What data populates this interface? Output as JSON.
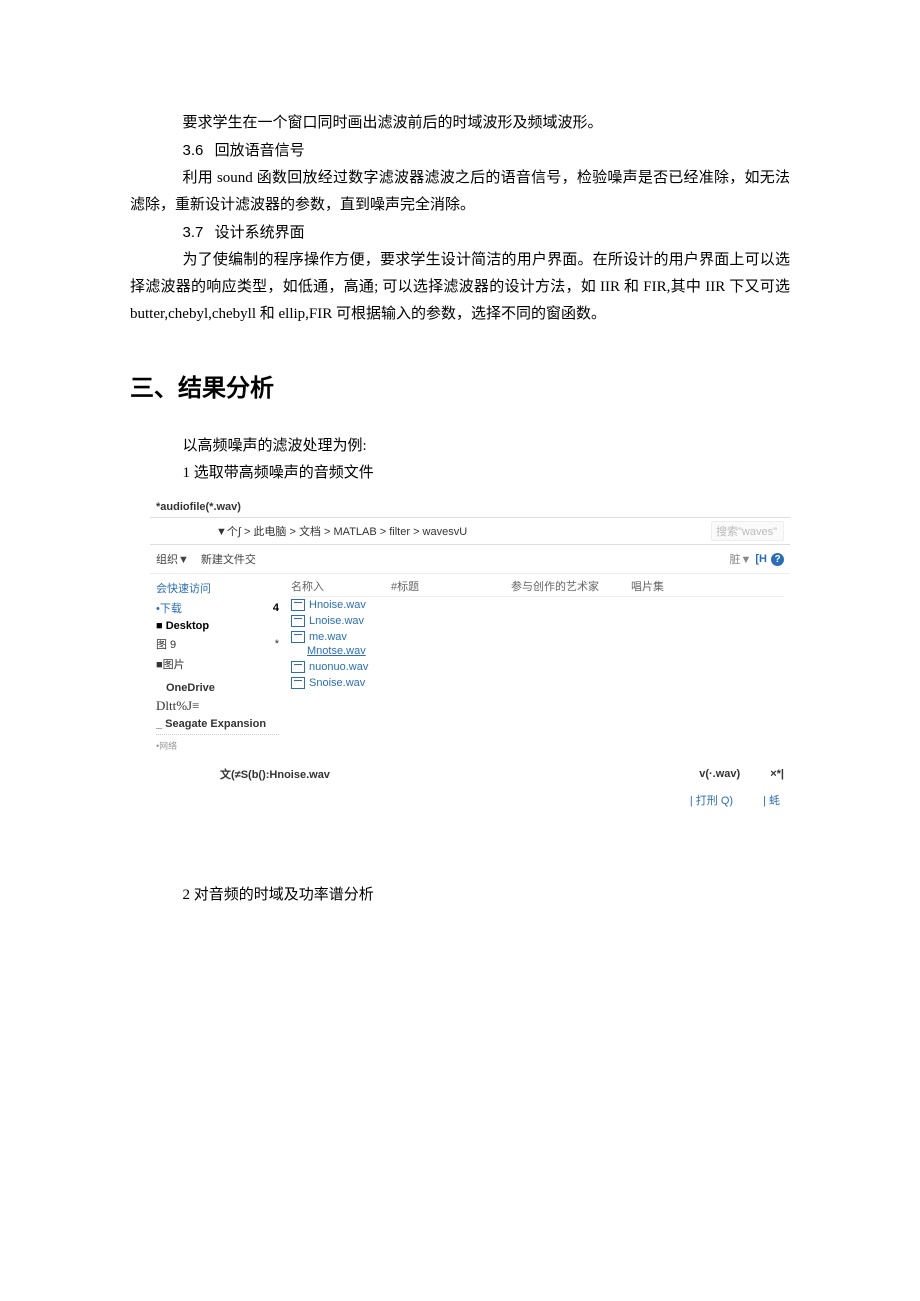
{
  "para1": "要求学生在一个窗口同时画出滤波前后的时域波形及频域波形。",
  "sec36_num": "3.6",
  "sec36_title": "回放语音信号",
  "para2": "利用 sound 函数回放经过数字滤波器滤波之后的语音信号，检验噪声是否已经准除，如无法滤除，重新设计滤波器的参数，直到噪声完全消除。",
  "sec37_num": "3.7",
  "sec37_title": "设计系统界面",
  "para3": "为了使编制的程序操作方便，要求学生设计简洁的用户界面。在所设计的用户界面上可以选择滤波器的响应类型，如低通，高通; 可以选择滤波器的设计方法，如 IIR 和 FIR,其中 IIR 下又可选 butter,chebyl,chebyll 和 ellip,FIR 可根据输入的参数，选择不同的窗函数。",
  "h2": "三、结果分析",
  "example_intro": "以高频噪声的滤波处理为例:",
  "step1": "1 选取带高频噪声的音频文件",
  "step2": "2 对音频的时域及功率谱分析",
  "dialog": {
    "title": "*audiofile(*.wav)",
    "path": "▼个∫ > 此电脑 > 文档 > MATLAB > filter > wavesvU",
    "search_placeholder": "搜索\"waves\"",
    "organize": "组织▼",
    "new_folder": "新建文件交",
    "right_ctl_pre": "脏▼",
    "right_ctl_bracket": "[H",
    "headers": {
      "name": "名称入",
      "title": "#标题",
      "artist": "参与创作的艺术家",
      "album": "唱片集"
    },
    "sidebar": {
      "quick": "会快速访问",
      "downloads": "•下载",
      "downloads_badge": "4",
      "desktop": "■ Desktop",
      "pic9": "图 9",
      "pic9_badge": "*",
      "pictures": "■图片",
      "onedrive": "OneDrive",
      "dltt": "Dltt%J≡",
      "seagate": "_ Seagate Expansion",
      "net": "•网络"
    },
    "files": [
      "Hnoise.wav",
      "Lnoise.wav",
      "me.wav",
      "Mnotse.wav",
      "nuonuo.wav",
      "Snoise.wav"
    ],
    "filename_label": "文(≠S(b():Hnoise.wav",
    "filetype": "v(·.wav)",
    "x": "×*|",
    "open": "| 打刑 Q)",
    "cancel": "| 蚝"
  }
}
